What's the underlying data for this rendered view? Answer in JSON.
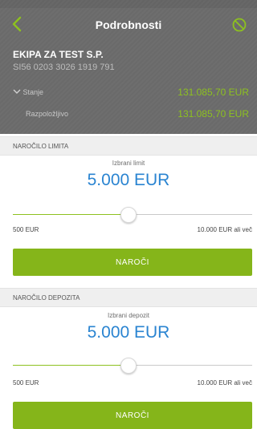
{
  "nav": {
    "title": "Podrobnosti",
    "back_icon": "chevron-left-icon",
    "action_icon": "block-icon"
  },
  "colors": {
    "accent_green": "#8dc11f",
    "button_green": "#85b51a",
    "amount_blue": "#2a84d1"
  },
  "account": {
    "name": "EKIPA ZA TEST S.P.",
    "iban": "SI56 0203 3026 1919 791",
    "balance_label": "Stanje",
    "balance_value": "131.085,70 EUR",
    "available_label": "Razpoložljivo",
    "available_value": "131.085,70 EUR"
  },
  "limit_section": {
    "title": "NAROČILO LIMITA",
    "caption": "Izbrani limit",
    "amount": "5.000 EUR",
    "min_label": "500 EUR",
    "max_label": "10.000 EUR ali več",
    "slider_value": 0.48,
    "button_label": "NAROČI"
  },
  "deposit_section": {
    "title": "NAROČILO DEPOZITA",
    "caption": "Izbrani depozit",
    "amount": "5.000 EUR",
    "min_label": "500 EUR",
    "max_label": "10.000 EUR ali več",
    "slider_value": 0.48,
    "button_label": "NAROČI"
  }
}
